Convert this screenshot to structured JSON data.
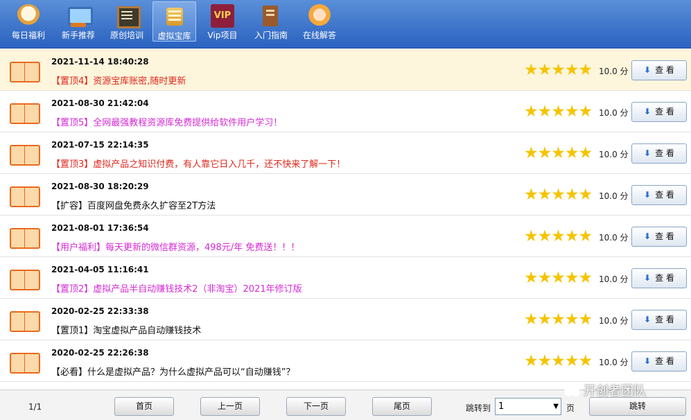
{
  "toolbar": {
    "items": [
      {
        "label": "每日福利",
        "icon": "lucky-cat-icon"
      },
      {
        "label": "新手推荐",
        "icon": "monitor-icon"
      },
      {
        "label": "原创培训",
        "icon": "blackboard-icon"
      },
      {
        "label": "虚拟宝库",
        "icon": "database-icon",
        "active": true
      },
      {
        "label": "Vip项目",
        "icon": "vip-icon",
        "icon_text": "VIP"
      },
      {
        "label": "入门指南",
        "icon": "book-icon"
      },
      {
        "label": "在线解答",
        "icon": "support-agent-icon"
      }
    ]
  },
  "colors": {
    "toolbar_bg": "#2a62c0",
    "highlight_row": "#fdf5dc",
    "red": "#e0261b",
    "magenta": "#d42ad4",
    "star": "#f5c400"
  },
  "list": {
    "rows": [
      {
        "date": "2021-11-14 18:40:28",
        "title": "【置顶4】资源宝库账密,随时更新",
        "title_color": "#e0261b",
        "rating": 5,
        "score": "10.0 分",
        "button": "查 看",
        "highlighted": true
      },
      {
        "date": "2021-08-30 21:42:04",
        "title": "【置顶5】全网最强教程资源库免费提供给软件用户学习！",
        "title_color": "#d42ad4",
        "rating": 5,
        "score": "10.0 分",
        "button": "查 看"
      },
      {
        "date": "2021-07-15 22:14:35",
        "title": "【置顶3】虚拟产品之知识付费，有人靠它日入几千，还不快来了解一下！",
        "title_color": "#e0261b",
        "rating": 5,
        "score": "10.0 分",
        "button": "查 看"
      },
      {
        "date": "2021-08-30 18:20:29",
        "title": "【扩容】百度网盘免费永久扩容至2T方法",
        "title_color": "#111111",
        "rating": 5,
        "score": "10.0 分",
        "button": "查 看"
      },
      {
        "date": "2021-08-01 17:36:54",
        "title": "【用户福利】每天更新的微信群资源，498元/年 免费送！！！",
        "title_color": "#d42ad4",
        "rating": 5,
        "score": "10.0 分",
        "button": "查 看"
      },
      {
        "date": "2021-04-05 11:16:41",
        "title": "【置顶2】虚拟产品半自动赚钱技术2（非淘宝）2021年修订版",
        "title_color": "#d42ad4",
        "rating": 5,
        "score": "10.0 分",
        "button": "查 看"
      },
      {
        "date": "2020-02-25 22:33:38",
        "title": "【置顶1】淘宝虚拟产品自动赚钱技术",
        "title_color": "#111111",
        "rating": 5,
        "score": "10.0 分",
        "button": "查 看"
      },
      {
        "date": "2020-02-25 22:26:38",
        "title": "【必看】什么是虚拟产品？为什么虚拟产品可以“自动赚钱”？",
        "title_color": "#111111",
        "rating": 5,
        "score": "10.0 分",
        "button": "查 看"
      }
    ]
  },
  "pager": {
    "page_info": "1/1",
    "first": "首页",
    "prev": "上一页",
    "next": "下一页",
    "last": "尾页",
    "jump_label": "跳转到",
    "selected_page": "1",
    "page_unit": "页",
    "jump_button": "跳转"
  },
  "watermark": "开创者团队"
}
